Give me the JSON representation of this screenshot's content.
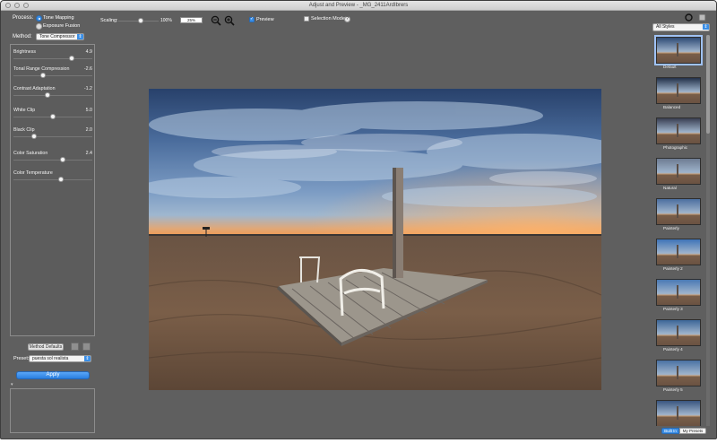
{
  "window": {
    "title": "Adjust and Preview - _MG_2411ArdIbrers"
  },
  "process": {
    "label": "Process:",
    "options": [
      "Tone Mapping",
      "Exposure Fusion"
    ],
    "selected": "Tone Mapping"
  },
  "method": {
    "label": "Method:",
    "value": "Tone Compressor"
  },
  "sliders": [
    {
      "name": "Brightness",
      "value": "4.9",
      "level": 0.74
    },
    {
      "name": "Tonal Range Compression",
      "value": "-2.6",
      "level": 0.38
    },
    {
      "name": "Contrast Adaptation",
      "value": "-1.2",
      "level": 0.43
    },
    {
      "name": "White Clip",
      "value": "5.0",
      "level": 0.5
    },
    {
      "name": "Black Clip",
      "value": "2.0",
      "level": 0.26
    },
    {
      "name": "Color Saturation",
      "value": "2.4",
      "level": 0.62
    },
    {
      "name": "Color Temperature",
      "value": "",
      "level": 0.6
    }
  ],
  "method_defaults": {
    "label": "Method Defaults"
  },
  "preset": {
    "label": "Preset:",
    "value": "puesta sol realista"
  },
  "apply": {
    "label": "Apply"
  },
  "toolbar": {
    "scaling_label": "Scaling:",
    "scaling_value": "100%",
    "scaling_level": 0.55,
    "zoom_field": "25%",
    "preview_label": "Preview",
    "preview_checked": true,
    "selection_mode_label": "Selection Mode",
    "selection_mode_checked": false,
    "help_glyph": "?"
  },
  "styles": {
    "filter_value": "All Styles",
    "thumbnails": [
      {
        "label": "Default",
        "selected": true
      },
      {
        "label": "Balanced",
        "selected": false
      },
      {
        "label": "Photographic",
        "selected": false
      },
      {
        "label": "Natural",
        "selected": false
      },
      {
        "label": "Painterly",
        "selected": false
      },
      {
        "label": "Painterly 2",
        "selected": false
      },
      {
        "label": "Painterly 3",
        "selected": false
      },
      {
        "label": "Painterly 4",
        "selected": false
      },
      {
        "label": "Painterly 5",
        "selected": false
      },
      {
        "label": "",
        "selected": false
      }
    ],
    "tabs": {
      "builtin": "Built In",
      "mypresets": "My Presets"
    }
  },
  "colors": {
    "accent": "#3a8ee6",
    "window_bg": "#5f5f5f"
  }
}
